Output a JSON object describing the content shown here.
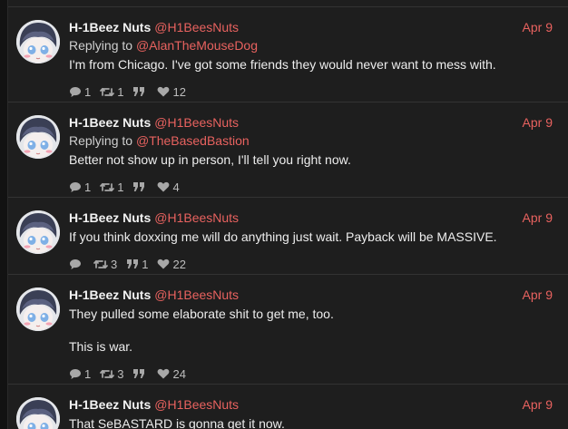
{
  "posts": [
    {
      "name": "H-1Beez Nuts",
      "handle": "@H1BeesNuts",
      "date": "Apr 9",
      "replying_to": "Replying to",
      "reply_handle": "@AlanTheMouseDog",
      "text": [
        "I'm from Chicago. I've got some friends they would never want to mess with."
      ],
      "replies": "1",
      "reblogs": "1",
      "quotes": "",
      "likes": "12"
    },
    {
      "name": "H-1Beez Nuts",
      "handle": "@H1BeesNuts",
      "date": "Apr 9",
      "replying_to": "Replying to",
      "reply_handle": "@TheBasedBastion",
      "text": [
        "Better not show up in person, I'll tell you right now."
      ],
      "replies": "1",
      "reblogs": "1",
      "quotes": "",
      "likes": "4"
    },
    {
      "name": "H-1Beez Nuts",
      "handle": "@H1BeesNuts",
      "date": "Apr 9",
      "text": [
        "If you think doxxing me will do anything just wait. Payback will be MASSIVE."
      ],
      "replies": "",
      "reblogs": "3",
      "quotes": "1",
      "likes": "22"
    },
    {
      "name": "H-1Beez Nuts",
      "handle": "@H1BeesNuts",
      "date": "Apr 9",
      "text": [
        "They pulled some elaborate shit to get me, too.",
        "This is war."
      ],
      "replies": "1",
      "reblogs": "3",
      "quotes": "",
      "likes": "24"
    },
    {
      "name": "H-1Beez Nuts",
      "handle": "@H1BeesNuts",
      "date": "Apr 9",
      "text": [
        "That SeBASTARD is gonna get it now."
      ],
      "replies": "",
      "reblogs": "",
      "quotes": "",
      "likes": ""
    }
  ],
  "icons": {
    "reply": "comment-icon",
    "reblog": "retweet-icon",
    "quote": "quote-icon",
    "like": "heart-icon"
  },
  "colors": {
    "accent": "#e8625f",
    "background": "#1e1e1e"
  }
}
